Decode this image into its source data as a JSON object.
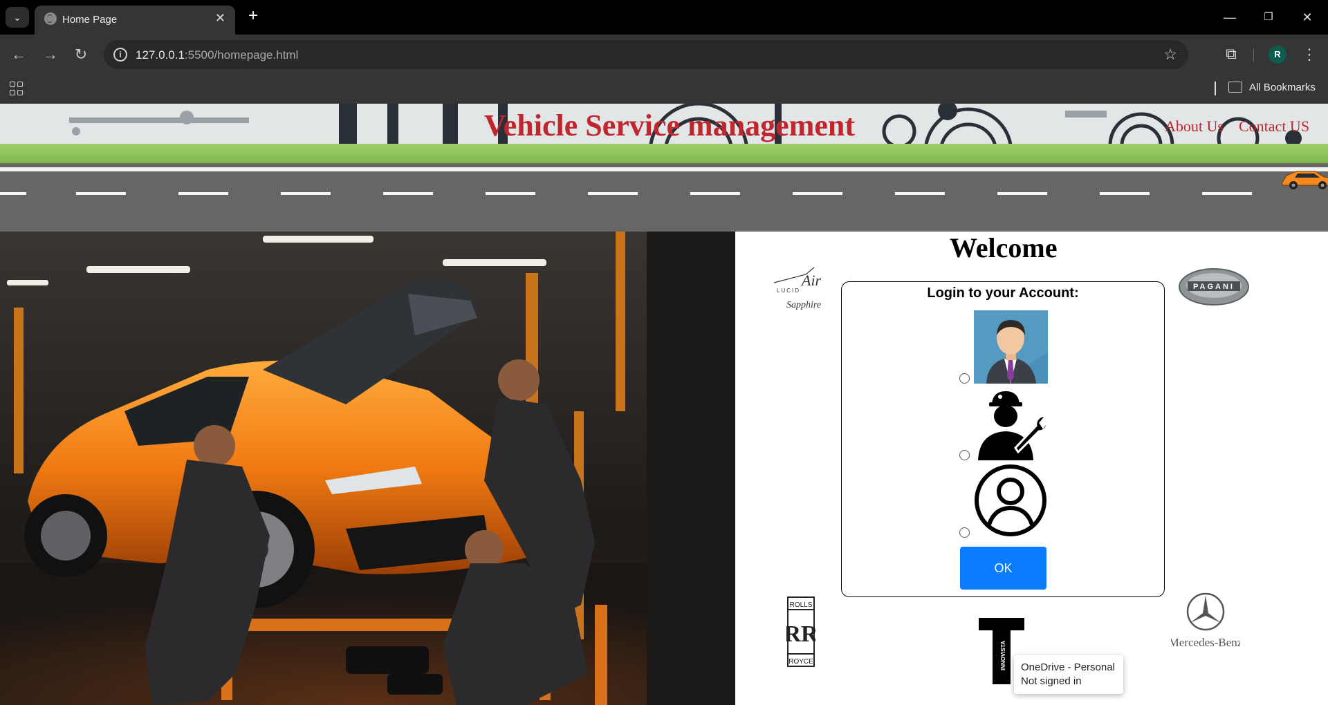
{
  "browser": {
    "tab_title": "Home Page",
    "url_host": "127.0.0.1",
    "url_rest": ":5500/homepage.html",
    "profile_initial": "R",
    "bookmarks_label": "All Bookmarks",
    "icons": [
      "tab-search-icon",
      "globe-icon",
      "close-icon",
      "plus-icon",
      "minimize-icon",
      "restore-icon",
      "close-window-icon",
      "back-icon",
      "forward-icon",
      "reload-icon",
      "info-icon",
      "star-icon",
      "extensions-icon",
      "menu-icon",
      "apps-icon",
      "folder-icon"
    ]
  },
  "header": {
    "title": "Vehicle Service management",
    "nav": [
      "About Us",
      "Contact US"
    ],
    "accent_color": "#c0262e"
  },
  "login": {
    "welcome": "Welcome",
    "title": "Login to your Account:",
    "roles": [
      "admin-avatar-icon",
      "mechanic-icon",
      "user-icon"
    ],
    "ok_label": "OK",
    "button_color": "#0a7cff"
  },
  "brands": {
    "lucid_top": "Air",
    "lucid_mid": "LUCID",
    "lucid_bottom": "Sapphire",
    "pagani": "PAGANI",
    "rolls_top": "ROLLS",
    "rolls_mono": "RR",
    "rolls_bottom": "ROYCE",
    "innovista": "INNOVISTA",
    "mercedes": "Mercedes-Benz"
  },
  "toast": {
    "line1": "OneDrive - Personal",
    "line2": "Not signed in"
  }
}
